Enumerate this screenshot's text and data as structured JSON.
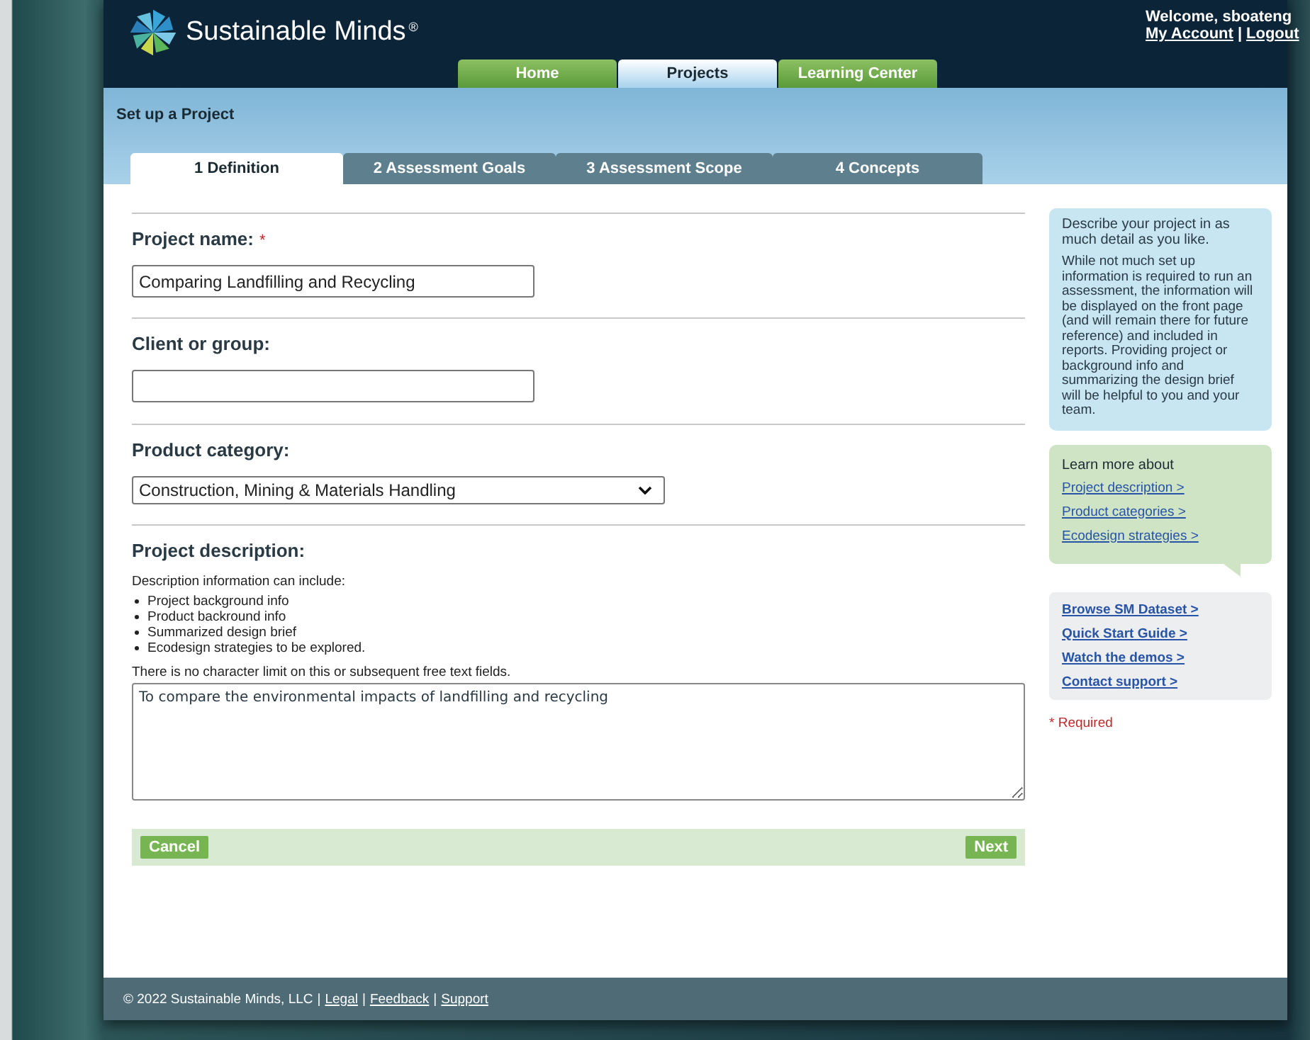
{
  "header": {
    "logo": {
      "name": "Sustainable Minds",
      "mark": "®"
    },
    "user": {
      "welcome": "Welcome, sboateng",
      "links": [
        "My Account",
        "Logout"
      ],
      "separator": "|"
    }
  },
  "nav_tabs": [
    {
      "label": "Home",
      "selected": false
    },
    {
      "label": "Projects",
      "selected": true
    },
    {
      "label": "Learning Center",
      "selected": false
    }
  ],
  "page_title": "Set up a Project",
  "steps": [
    {
      "label": "1 Definition",
      "selected": true
    },
    {
      "label": "2 Assessment Goals",
      "selected": false
    },
    {
      "label": "3 Assessment Scope",
      "selected": false
    },
    {
      "label": "4 Concepts",
      "selected": false
    }
  ],
  "fields": [
    {
      "kind": "text",
      "label": "Project name:",
      "required_mark": "*",
      "value": "Comparing Landfilling and Recycling"
    },
    {
      "kind": "text",
      "label": "Client or group:"
    },
    {
      "kind": "select",
      "label": "Product category:",
      "value": "Construction, Mining & Materials Handling"
    },
    {
      "kind": "textarea",
      "label": "Project description:",
      "intro": "Description information can include:",
      "bullets": [
        "Project background info",
        "Product backround info",
        "Summarized design brief",
        "Ecodesign strategies to be explored."
      ],
      "note": "There is no character limit on this or subsequent free text fields.",
      "value": "To compare the environmental impacts of landfilling and recycling"
    }
  ],
  "buttons": {
    "cancel": "Cancel",
    "next": "Next"
  },
  "sidebar": {
    "help": {
      "heading": "Describe your project in as much detail as you like.",
      "body": "While not much set up information is required to run an assessment, the information will be displayed on the front page (and will remain there for future reference) and included in reports. Providing project or background info and summarizing the design brief will be helpful to you and your team."
    },
    "learn_more": {
      "heading": "Learn more about",
      "links": [
        "Project description >",
        "Product categories >",
        "Ecodesign strategies >"
      ]
    },
    "resources": [
      "Browse SM Dataset >",
      "Quick Start Guide >",
      "Watch the demos >",
      "Contact support >"
    ],
    "required_note": "* Required"
  },
  "footer": {
    "copyright": "© 2022 Sustainable Minds, LLC",
    "separator": "|",
    "links": [
      "Legal",
      "Feedback",
      "Support"
    ]
  }
}
